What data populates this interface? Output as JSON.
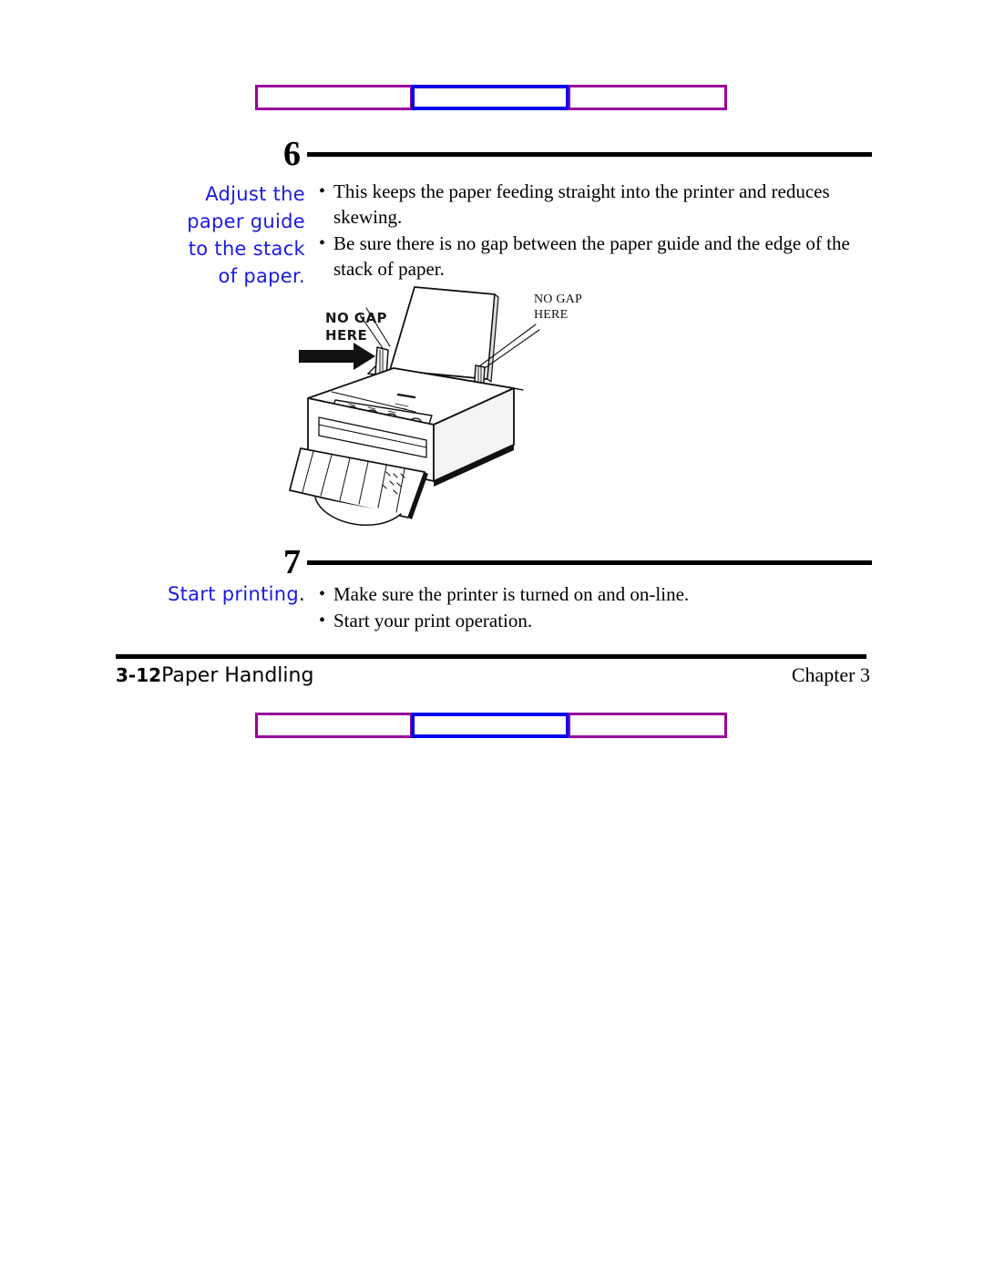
{
  "document": {
    "title": "Paper Handling — Step 6 and Step 7"
  },
  "decor": {
    "purple": "#990099",
    "blue": "#0000ee",
    "segments": [
      "purple",
      "blue",
      "purple"
    ]
  },
  "steps": [
    {
      "number": "6",
      "caption_lines": [
        "Adjust the",
        "paper guide",
        "to the stack",
        "of paper."
      ],
      "caption_color": "#1a1ae6",
      "bullets": [
        "This keeps the paper feeding straight into the printer and reduces skewing.",
        "Be sure there is no gap between the paper guide and the edge of the stack of paper."
      ]
    },
    {
      "number": "7",
      "caption_lines": [
        "Start printing"
      ],
      "caption_period": ".",
      "caption_color": "#1a1ae6",
      "bullets": [
        "Make sure the printer is turned on and on-line.",
        "Start your print operation."
      ]
    }
  ],
  "illustration": {
    "name": "inkjet-printer-paper-guide-diagram",
    "callout_left": {
      "line1": "NO GAP",
      "line2": "HERE"
    },
    "callout_right": {
      "line1": "NO GAP",
      "line2": "HERE"
    }
  },
  "footer": {
    "page_number": "3-12",
    "section": "Paper Handling",
    "chapter": "Chapter 3"
  },
  "bullet_glyph": "•"
}
